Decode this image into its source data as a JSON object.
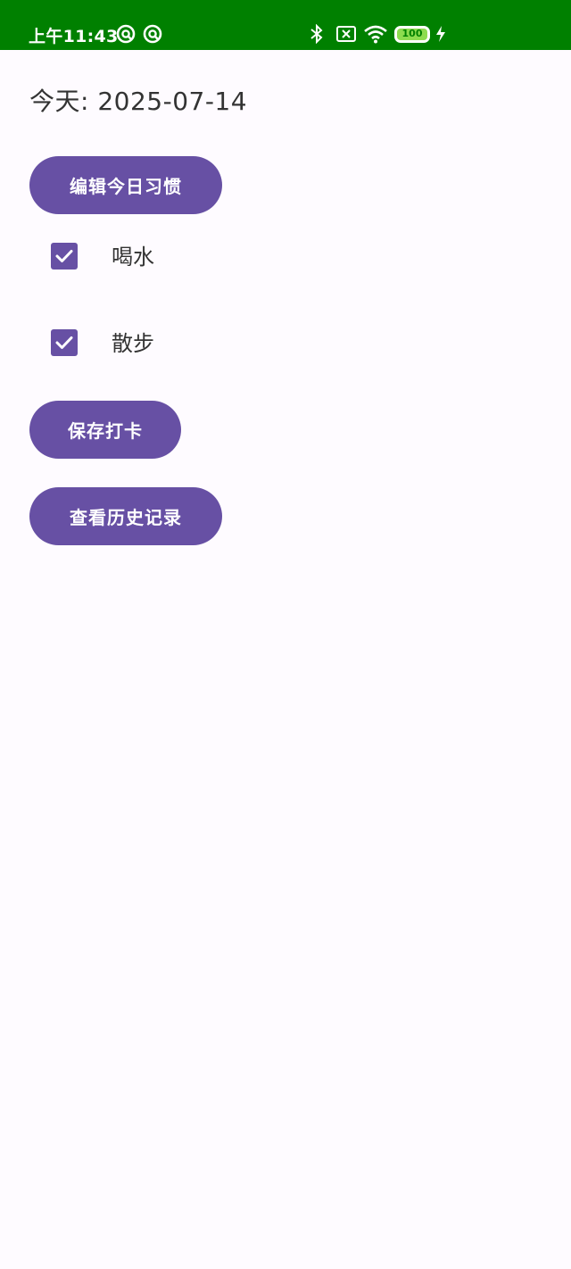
{
  "status_bar": {
    "time": "上午11:43",
    "battery_level": "100",
    "bg_color": "#008000",
    "icons": [
      "app-notification-icon",
      "app-notification-icon",
      "bluetooth-icon",
      "sim-off-icon",
      "wifi-icon",
      "battery-icon",
      "charging-icon"
    ]
  },
  "main": {
    "date_label": "今天: 2025-07-14",
    "edit_button": "编辑今日习惯",
    "habits": [
      {
        "label": "喝水",
        "checked": true
      },
      {
        "label": "散步",
        "checked": true
      }
    ],
    "save_button": "保存打卡",
    "history_button": "查看历史记录"
  },
  "colors": {
    "accent": "#6750a4",
    "background": "#fefbff",
    "text": "#333333"
  }
}
